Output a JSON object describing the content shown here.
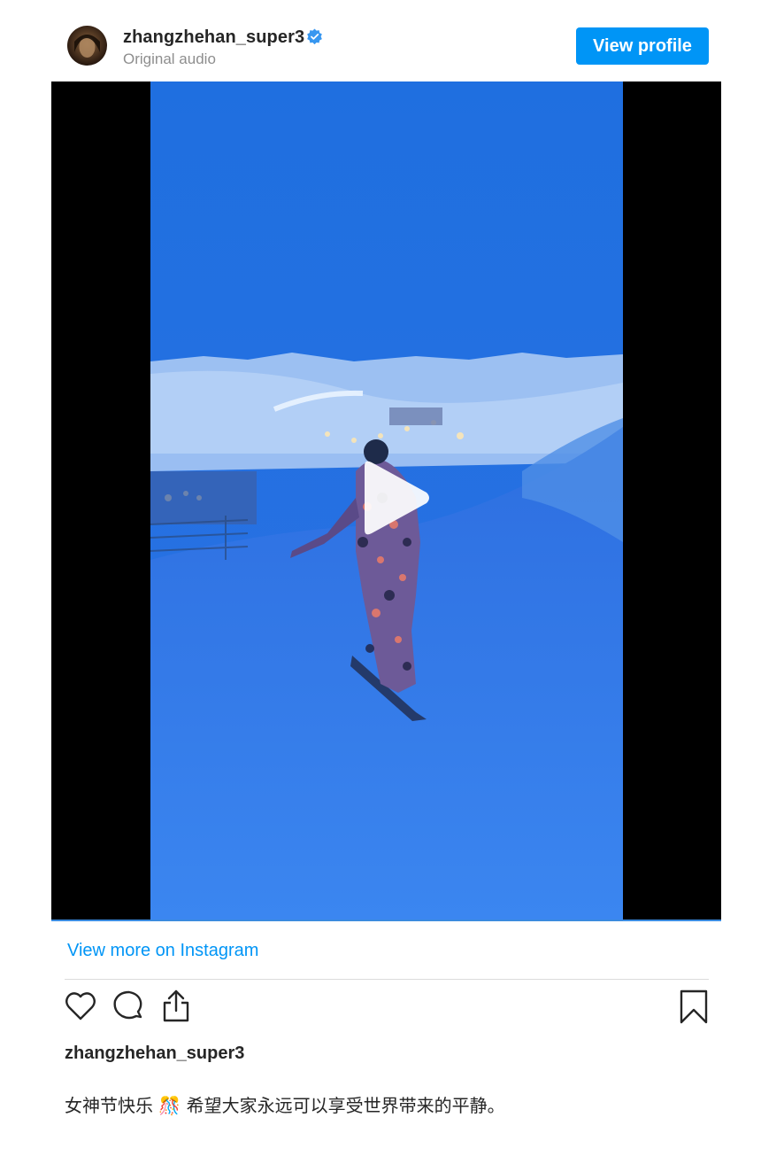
{
  "header": {
    "username": "zhangzhehan_super3",
    "subtitle": "Original audio",
    "view_profile_label": "View profile",
    "verified_icon": "verified-badge-icon"
  },
  "video": {
    "play_icon": "play-icon"
  },
  "footer": {
    "view_more_label": "View more on Instagram",
    "owner": "zhangzhehan_super3",
    "caption_part1": "女神节快乐",
    "caption_emoji": "🎊",
    "caption_part2": "希望大家永远可以享受世界带来的平静。"
  },
  "icons": {
    "like": "heart-icon",
    "comment": "comment-icon",
    "share": "share-icon",
    "save": "bookmark-icon"
  },
  "colors": {
    "accent": "#0095f6",
    "text": "#262626",
    "muted": "#8e8e8e",
    "verified": "#3897f0"
  }
}
